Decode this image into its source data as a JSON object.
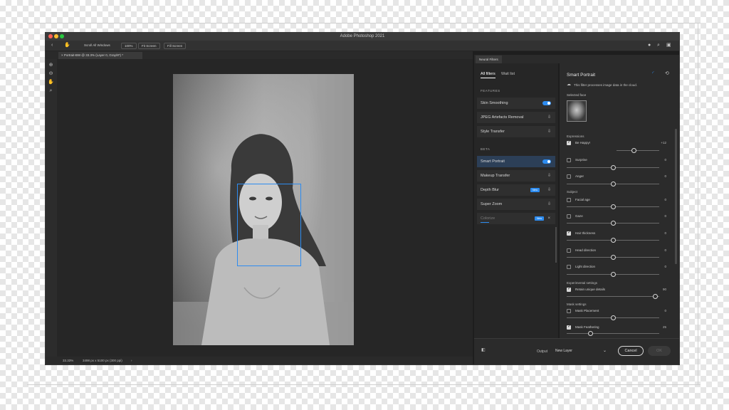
{
  "app": {
    "title": "Adobe Photoshop 2021"
  },
  "options_bar": {
    "scroll_all_windows": "Scroll All Windows",
    "zoom_100": "100%",
    "fit_screen": "Fit Screen",
    "fill_screen": "Fill Screen"
  },
  "document": {
    "tab_title": "Portrait-BW @ 33.3% (Layer 0, Gray/8*) *"
  },
  "status": {
    "zoom": "33.33%",
    "doc_info": "3498 px x 5100 px (300 ppi)"
  },
  "neural_filters": {
    "panel_tab": "Neural Filters",
    "tabs": {
      "all_filters": "All filters",
      "wait_list": "Wait list"
    },
    "features_label": "FEATURES",
    "beta_label": "BETA",
    "features": [
      {
        "label": "Skin Smoothing"
      },
      {
        "label": "JPEG Artefacts Removal"
      },
      {
        "label": "Style Transfer"
      }
    ],
    "beta": [
      {
        "label": "Smart Portrait"
      },
      {
        "label": "Makeup Transfer"
      },
      {
        "label": "Depth Blur",
        "badge": "New"
      },
      {
        "label": "Super Zoom"
      },
      {
        "label": "Colorize",
        "badge": "New"
      }
    ]
  },
  "smart_portrait": {
    "title": "Smart Portrait",
    "cloud_note": "This filter processes image data in the cloud.",
    "selected_face_label": "Selected face",
    "expressions_label": "Expressions",
    "subject_label": "Subject",
    "experimental_label": "Experimental settings",
    "mask_label": "Mask settings",
    "expressions": [
      {
        "label": "Be Happy!",
        "value": "+12"
      },
      {
        "label": "Surprise",
        "value": "0"
      },
      {
        "label": "Anger",
        "value": "0"
      }
    ],
    "subject": [
      {
        "label": "Facial age",
        "value": "0"
      },
      {
        "label": "Gaze",
        "value": "0"
      },
      {
        "label": "Hair thickness",
        "value": "0"
      },
      {
        "label": "Head direction",
        "value": "0"
      },
      {
        "label": "Light direction",
        "value": "0"
      }
    ],
    "experimental": [
      {
        "label": "Retain unique details",
        "value": "90"
      }
    ],
    "mask": [
      {
        "label": "Mask Placement",
        "value": "0"
      },
      {
        "label": "Mask Feathering",
        "value": "25"
      }
    ]
  },
  "bottom": {
    "output_label": "Output",
    "output_value": "New Layer",
    "cancel": "Cancel",
    "ok": "OK"
  }
}
